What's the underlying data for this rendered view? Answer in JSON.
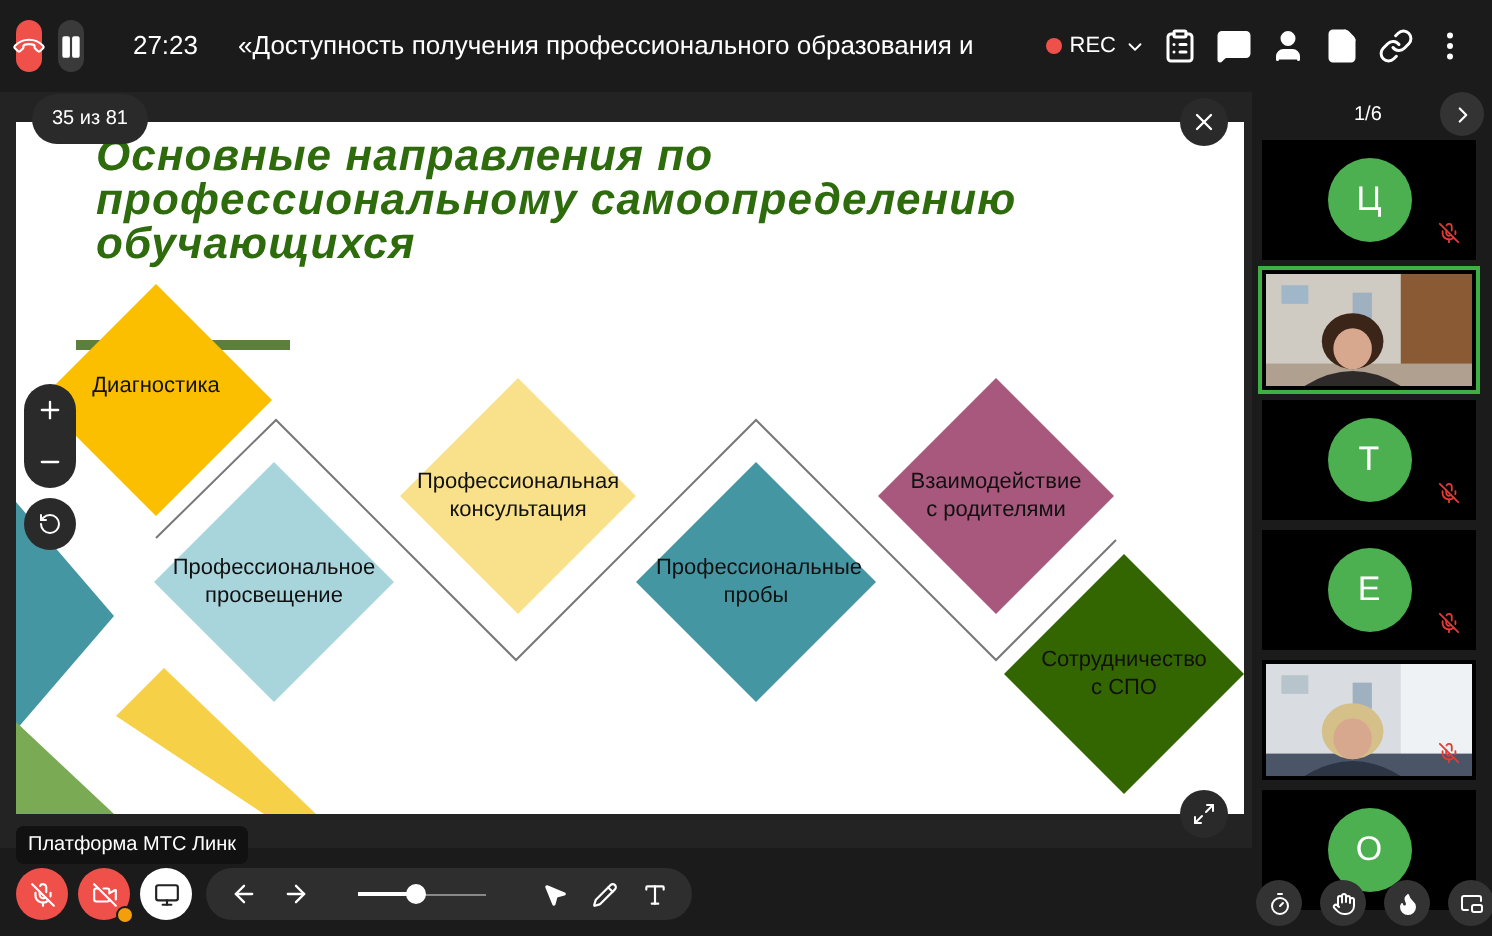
{
  "call": {
    "timer": "27:23",
    "title": "«Доступность получения профессионального образования и",
    "recording": {
      "label": "REC",
      "on": true
    }
  },
  "slide": {
    "counter": "35 из 81",
    "title": "Основные направления по профессиональному самоопределению обучающихся",
    "items": [
      {
        "label": "Диагностика",
        "color": "#fbbf00"
      },
      {
        "label": "Профессиональное просвещение",
        "color": "#a8d5dc"
      },
      {
        "label": "Профессиональная консультация",
        "color": "#f9e08a"
      },
      {
        "label": "Профессиональные пробы",
        "color": "#4596a3"
      },
      {
        "label": "Взаимодействие с родителями",
        "color": "#a8587d"
      },
      {
        "label": "Сотрудничество с СПО",
        "color": "#336600"
      }
    ],
    "caption": "Платформа МТС Линк"
  },
  "participants": {
    "page": "1/6",
    "tiles": [
      {
        "kind": "avatar",
        "initial": "Ц",
        "muted": true,
        "speaking": false
      },
      {
        "kind": "video",
        "muted": false,
        "speaking": true
      },
      {
        "kind": "avatar",
        "initial": "Т",
        "muted": true,
        "speaking": false
      },
      {
        "kind": "avatar",
        "initial": "Е",
        "muted": true,
        "speaking": false
      },
      {
        "kind": "video",
        "muted": true,
        "speaking": false
      },
      {
        "kind": "avatar",
        "initial": "О",
        "muted": false,
        "speaking": false
      }
    ]
  },
  "controls": {
    "mic_on": false,
    "camera_on": false,
    "camera_warning": true,
    "screen_share": true,
    "zoom": {
      "level": 0.45
    }
  }
}
